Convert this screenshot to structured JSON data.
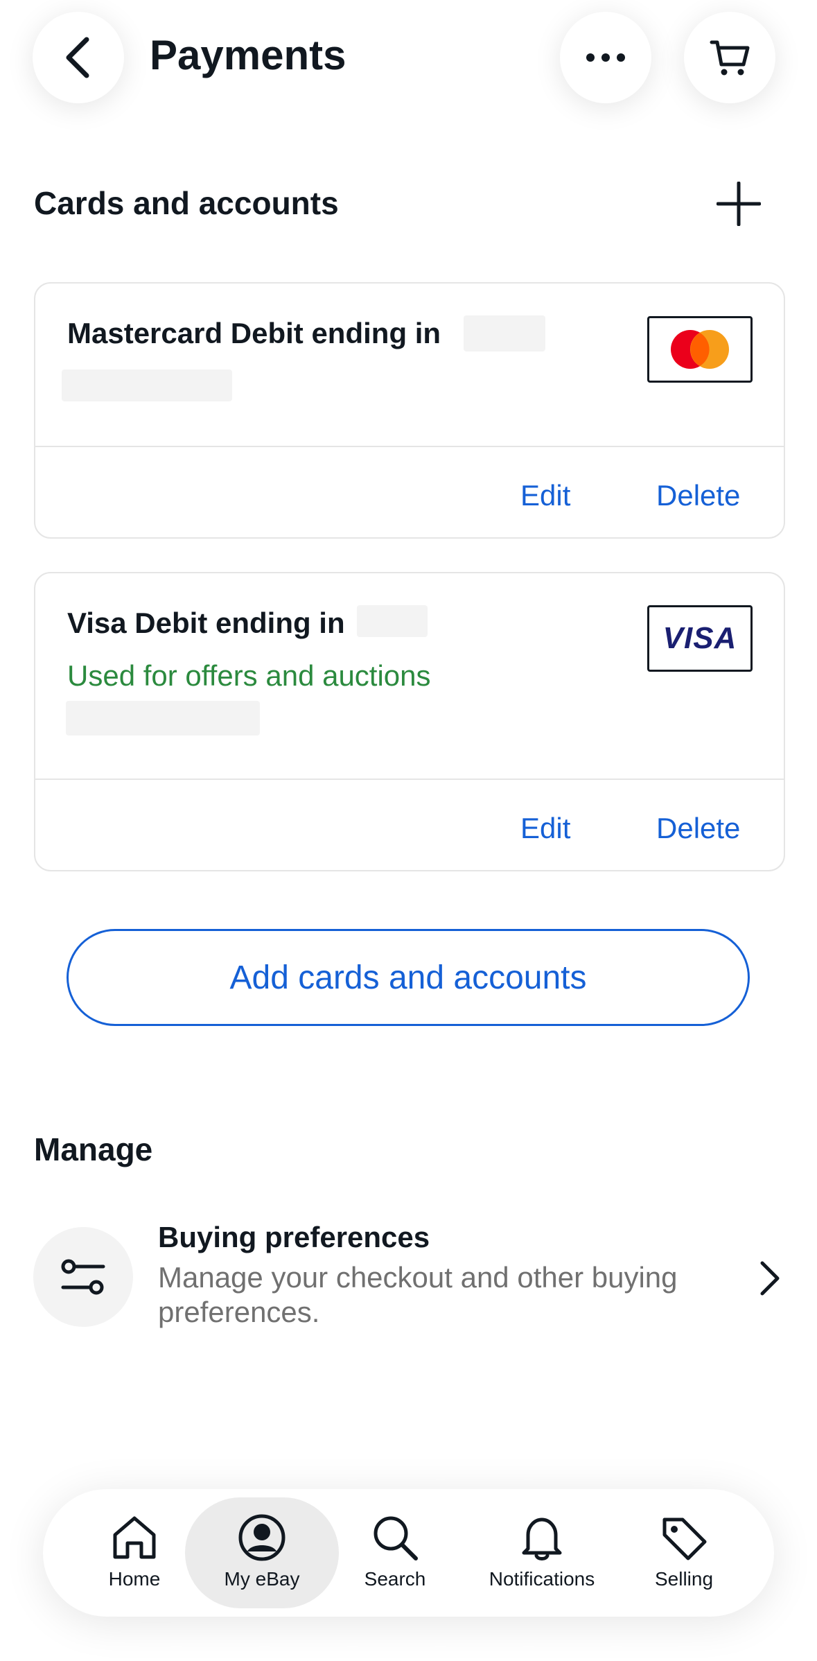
{
  "header": {
    "title": "Payments",
    "back_icon": "chevron-left-icon",
    "more_icon": "more-horizontal-icon",
    "cart_icon": "cart-icon"
  },
  "cards_section": {
    "title": "Cards and accounts",
    "add_icon": "plus-icon",
    "cards": [
      {
        "title": "Mastercard Debit ending in",
        "brand": "mastercard",
        "edit_label": "Edit",
        "delete_label": "Delete"
      },
      {
        "title": "Visa Debit ending in",
        "status": "Used for offers and auctions",
        "brand": "VISA",
        "edit_label": "Edit",
        "delete_label": "Delete"
      }
    ],
    "add_button_label": "Add cards and accounts"
  },
  "manage": {
    "title": "Manage",
    "items": [
      {
        "title": "Buying preferences",
        "description": "Manage your checkout and other buying preferences.",
        "icon": "sliders-icon"
      }
    ]
  },
  "bottom_nav": {
    "items": [
      {
        "label": "Home",
        "icon": "home-icon"
      },
      {
        "label": "My eBay",
        "icon": "user-circle-icon",
        "active": true
      },
      {
        "label": "Search",
        "icon": "search-icon"
      },
      {
        "label": "Notifications",
        "icon": "bell-icon"
      },
      {
        "label": "Selling",
        "icon": "tag-icon"
      }
    ]
  },
  "colors": {
    "accent": "#1560d6",
    "success": "#2b8a3e",
    "text": "#111820",
    "muted": "#707070"
  }
}
